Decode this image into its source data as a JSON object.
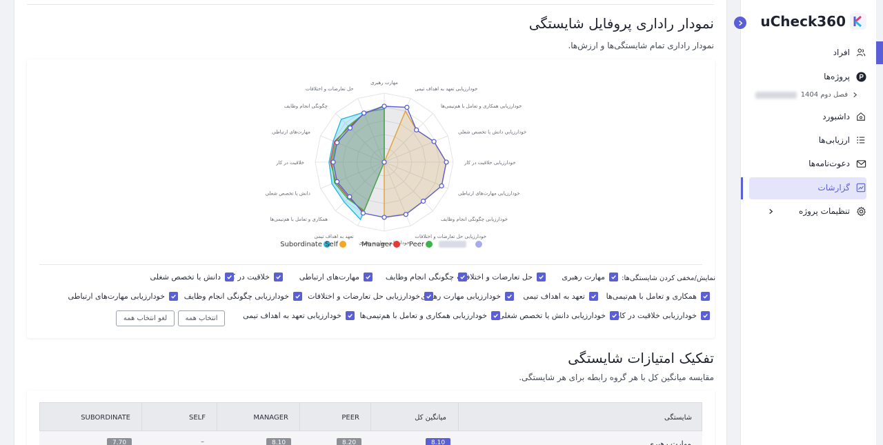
{
  "app": {
    "logo_text": "uCheck360",
    "logo_mark": "K"
  },
  "sidebar": {
    "items": [
      {
        "label": "افراد",
        "icon": "users-icon"
      },
      {
        "label": "پروژه‌ها",
        "icon": "project-p-icon"
      },
      {
        "label": "داشبورد",
        "icon": "home-icon"
      },
      {
        "label": "ارزیابی‌ها",
        "icon": "list-icon"
      },
      {
        "label": "دعوت‌نامه‌ها",
        "icon": "mail-icon"
      },
      {
        "label": "گزارشات",
        "icon": "chart-report-icon",
        "active": true
      },
      {
        "label": "تنظیمات پروژه",
        "icon": "gear-icon",
        "expandable": true
      }
    ],
    "project_label": "فصل دوم 1404",
    "accent_color": "#5b5fd6"
  },
  "radar_section": {
    "title": "نمودار راداری پروفایل شایستگی",
    "subtitle": "نمودار راداری تمام شایستگی‌ها و ارزش‌ها."
  },
  "chart_data": {
    "type": "radar",
    "axes": [
      "مهارت رهبری",
      "حل تعارضات و اختلافات",
      "چگونگی انجام وظایف",
      "مهارت‌های ارتباطی",
      "خلاقیت در کار",
      "دانش یا تخصص شغلی",
      "همکاری و تعامل با هم‌تیمی‌ها",
      "تعهد به اهداف تیمی",
      "خودارزیابی مهارت رهبری",
      "خودارزیابی حل تعارضات و اختلافات",
      "خودارزیابی چگونگی انجام وظایف",
      "خودارزیابی مهارت‌های ارتباطی",
      "خودارزیابی خلاقیت در کار",
      "خودارزیابی دانش یا تخصص شغلی",
      "خودارزیابی همکاری و تعامل با هم‌تیمی‌ها",
      "خودارزیابی تعهد به اهداف تیمی"
    ],
    "rmax": 10,
    "series": [
      {
        "name": "Subordinate",
        "color": "#22b8e0",
        "values": [
          7.7,
          7.8,
          8.8,
          8.0,
          8.0,
          8.2,
          8.2,
          9.0,
          0,
          0,
          0,
          0,
          0,
          0,
          0,
          0
        ]
      },
      {
        "name": "Self",
        "color": "#f5a623",
        "values": [
          0,
          0,
          0,
          0,
          0,
          0,
          0,
          0,
          8.0,
          8.2,
          8.0,
          9.0,
          9.0,
          7.8,
          6.6,
          8.0
        ]
      },
      {
        "name": "Manager",
        "color": "#e53935",
        "values": [
          8.1,
          7.6,
          7.2,
          7.8,
          7.8,
          7.6,
          7.3,
          7.8,
          0,
          0,
          0,
          0,
          0,
          0,
          0,
          0
        ]
      },
      {
        "name": "Peer",
        "color": "#3bb54a",
        "values": [
          8.2,
          7.6,
          7.4,
          7.6,
          7.6,
          7.8,
          7.5,
          7.6,
          0,
          0,
          0,
          0,
          0,
          0,
          0,
          0
        ]
      },
      {
        "name": "",
        "color": "#5b5fd6",
        "values": [
          8.1,
          7.7,
          7.0,
          7.4,
          7.4,
          7.4,
          7.1,
          8.0,
          8.0,
          8.2,
          8.0,
          9.0,
          9.0,
          7.8,
          6.6,
          8.6
        ]
      }
    ],
    "legend_placement": "bottom"
  },
  "legend": {
    "items": [
      {
        "label": "Subordinate",
        "color": "#22b8e0"
      },
      {
        "label": "Self",
        "color": "#f5a623"
      },
      {
        "label": "Manager",
        "color": "#e53935"
      },
      {
        "label": "Peer",
        "color": "#3bb54a"
      }
    ]
  },
  "toggles": {
    "label": "نمایش/مخفی کردن شایستگی‌ها:",
    "items": [
      "مهارت رهبری",
      "حل تعارضات و اختلافات",
      "چگونگی انجام وظایف",
      "مهارت‌های ارتباطی",
      "خلاقیت در کار",
      "دانش یا تخصص شغلی",
      "همکاری و تعامل با هم‌تیمی‌ها",
      "تعهد به اهداف تیمی",
      "خودارزیابی مهارت رهبری",
      "خودارزیابی حل تعارضات و اختلافات",
      "خودارزیابی چگونگی انجام وظایف",
      "خودارزیابی مهارت‌های ارتباطی",
      "خودارزیابی خلاقیت در کار",
      "خودارزیابی دانش یا تخصص شغلی",
      "خودارزیابی همکاری و تعامل با هم‌تیمی‌ها",
      "خودارزیابی تعهد به اهداف تیمی"
    ],
    "select_all": "انتخاب همه",
    "deselect_all": "لغو انتخاب همه"
  },
  "breakdown_section": {
    "title": "تفکیک امتیازات شایستگی",
    "subtitle": "مقایسه میانگین کل با هر گروه رابطه برای هر شایستگی."
  },
  "table": {
    "headers": [
      "شایستگی",
      "میانگین کل",
      "PEER",
      "MANAGER",
      "SELF",
      "SUBORDINATE"
    ],
    "rows": [
      {
        "name": "مهارت رهبری",
        "avg": "8.10",
        "peer": "8.20",
        "manager": "8.10",
        "self": "–",
        "subordinate": "7.70"
      }
    ]
  }
}
